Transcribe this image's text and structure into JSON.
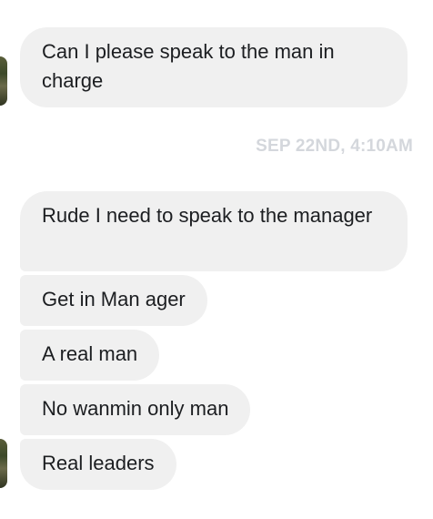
{
  "messages_group_1": [
    {
      "text": "Can I please speak to the man in charge"
    }
  ],
  "timestamp": "SEP 22ND, 4:10AM",
  "messages_group_2": [
    {
      "text": "Rude I need to speak to the manager"
    },
    {
      "text": "Get in Man ager"
    },
    {
      "text": "A real man"
    },
    {
      "text": "No wanmin only man"
    },
    {
      "text": "Real leaders"
    }
  ],
  "colors": {
    "bubble_bg": "#f0f0f0",
    "text": "#1c1e21",
    "timestamp": "#d4d7dc"
  }
}
